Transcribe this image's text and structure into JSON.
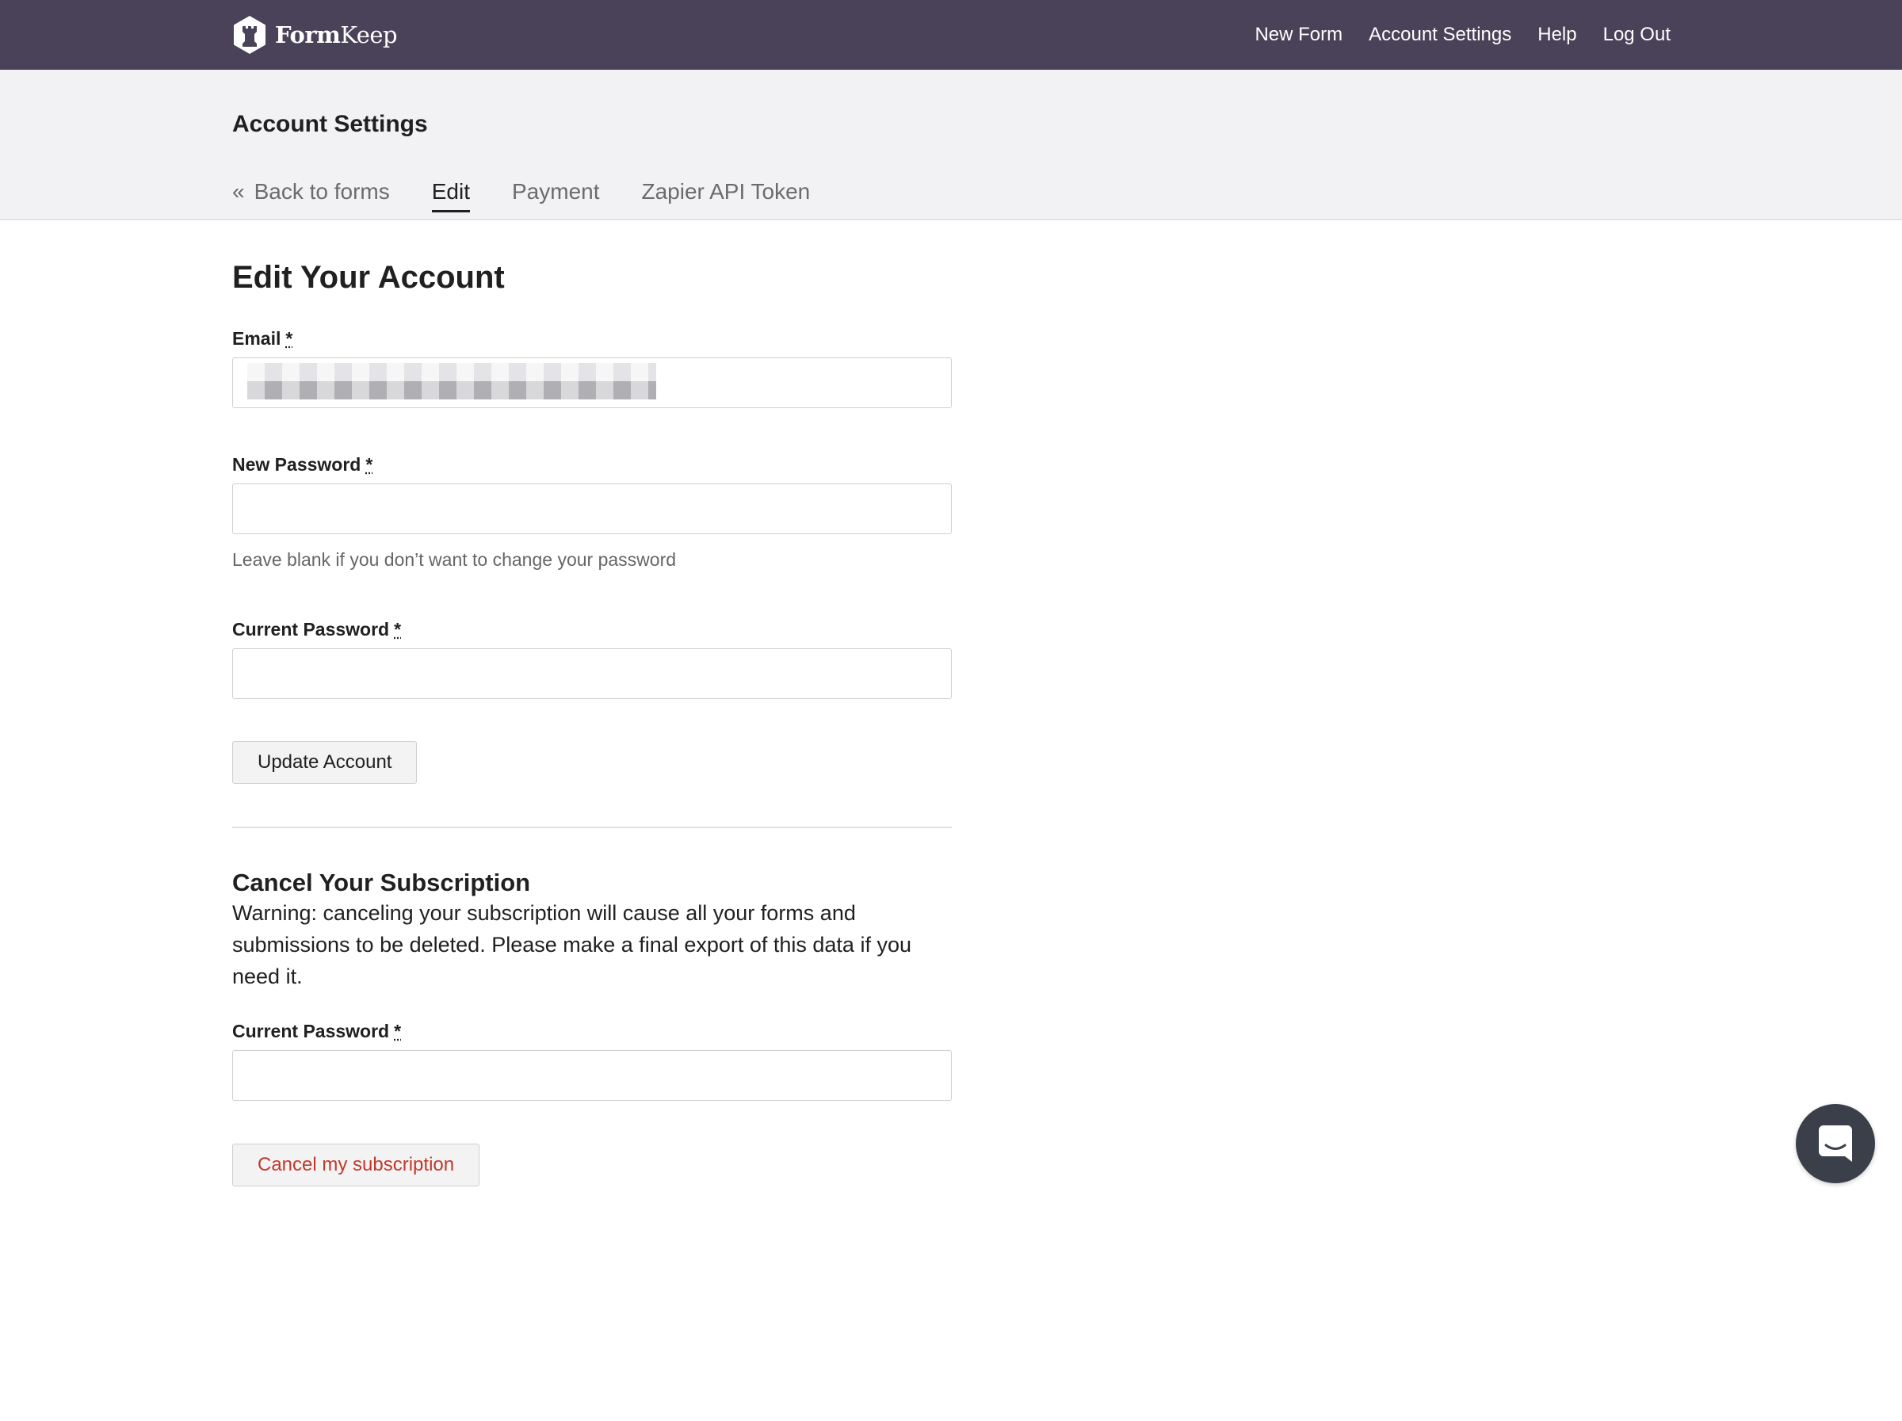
{
  "brand": {
    "name_bold": "Form",
    "name_rest": "Keep",
    "logo_icon": "rook-hexagon-icon"
  },
  "nav": {
    "items": [
      "New Form",
      "Account Settings",
      "Help",
      "Log Out"
    ]
  },
  "header": {
    "title": "Account Settings",
    "tabs": [
      {
        "label": "Back to forms",
        "prefix": "«",
        "active": false
      },
      {
        "label": "Edit",
        "active": true
      },
      {
        "label": "Payment",
        "active": false
      },
      {
        "label": "Zapier API Token",
        "active": false
      }
    ]
  },
  "edit_account": {
    "title": "Edit Your Account",
    "required_marker": "*",
    "email": {
      "label": "Email",
      "value": ""
    },
    "new_password": {
      "label": "New Password",
      "value": "",
      "hint": "Leave blank if you don’t want to change your password"
    },
    "current_password": {
      "label": "Current Password",
      "value": ""
    },
    "submit_label": "Update Account"
  },
  "cancel_subscription": {
    "title": "Cancel Your Subscription",
    "warning": "Warning: canceling your subscription will cause all your forms and submissions to be deleted. Please make a final export of this data if you need it.",
    "current_password": {
      "label": "Current Password",
      "value": ""
    },
    "submit_label": "Cancel my subscription"
  },
  "chat_widget": {
    "icon": "chat-bubble-icon"
  },
  "colors": {
    "topbar": "#4a4259",
    "subheader": "#f2f2f4",
    "danger": "#c0392b",
    "chat": "#3a3f4a"
  }
}
